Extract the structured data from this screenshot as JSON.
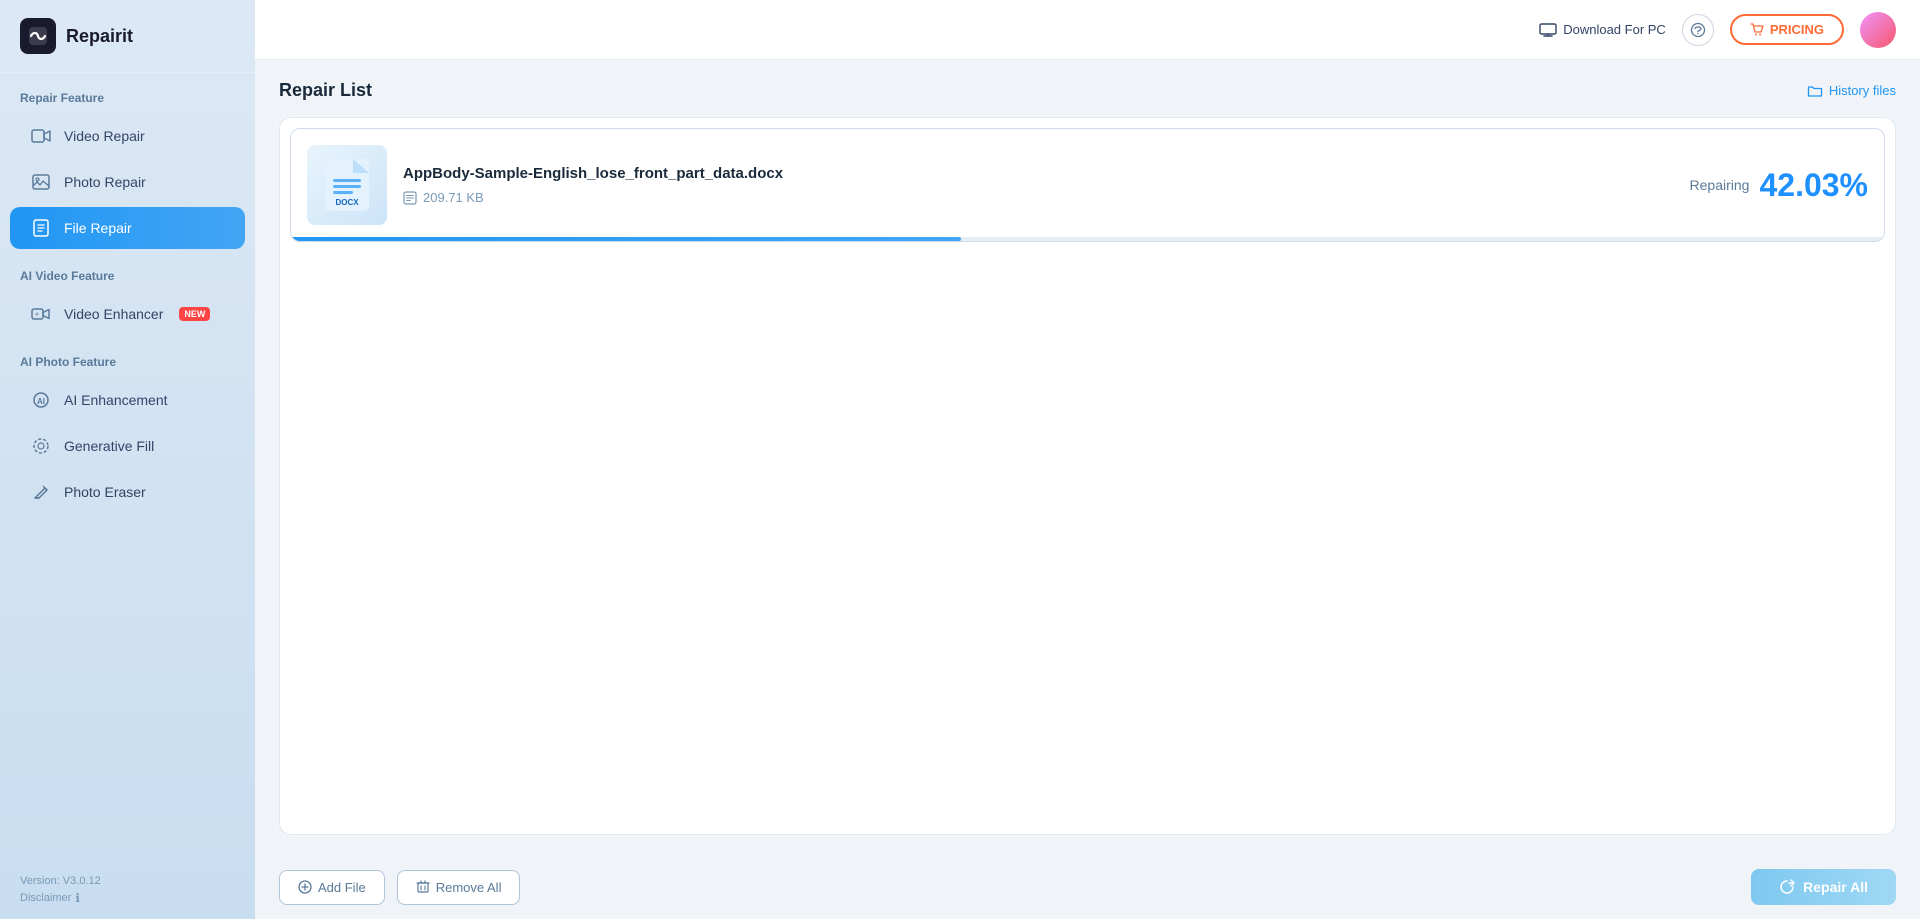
{
  "app": {
    "name": "Repairit"
  },
  "header": {
    "download_label": "Download For PC",
    "pricing_label": "PRICING",
    "history_label": "History files"
  },
  "sidebar": {
    "section_repair": "Repair Feature",
    "section_ai_video": "AI Video Feature",
    "section_ai_photo": "AI Photo Feature",
    "items": [
      {
        "id": "video-repair",
        "label": "Video Repair",
        "active": false
      },
      {
        "id": "photo-repair",
        "label": "Photo Repair",
        "active": false
      },
      {
        "id": "file-repair",
        "label": "File Repair",
        "active": true
      }
    ],
    "ai_video_items": [
      {
        "id": "video-enhancer",
        "label": "Video Enhancer",
        "badge": "NEW"
      }
    ],
    "ai_photo_items": [
      {
        "id": "ai-enhancement",
        "label": "AI Enhancement"
      },
      {
        "id": "generative-fill",
        "label": "Generative Fill"
      },
      {
        "id": "photo-eraser",
        "label": "Photo Eraser"
      }
    ],
    "version": "Version: V3.0.12",
    "disclaimer": "Disclaimer"
  },
  "main": {
    "repair_list_title": "Repair List",
    "file": {
      "name": "AppBody-Sample-English_lose_front_part_data.docx",
      "size": "209.71 KB",
      "status": "Repairing",
      "progress": 42.03,
      "progress_display": "42.03%"
    }
  },
  "bottom_bar": {
    "add_file": "Add File",
    "remove_all": "Remove All",
    "repair_all": "Repair All"
  }
}
